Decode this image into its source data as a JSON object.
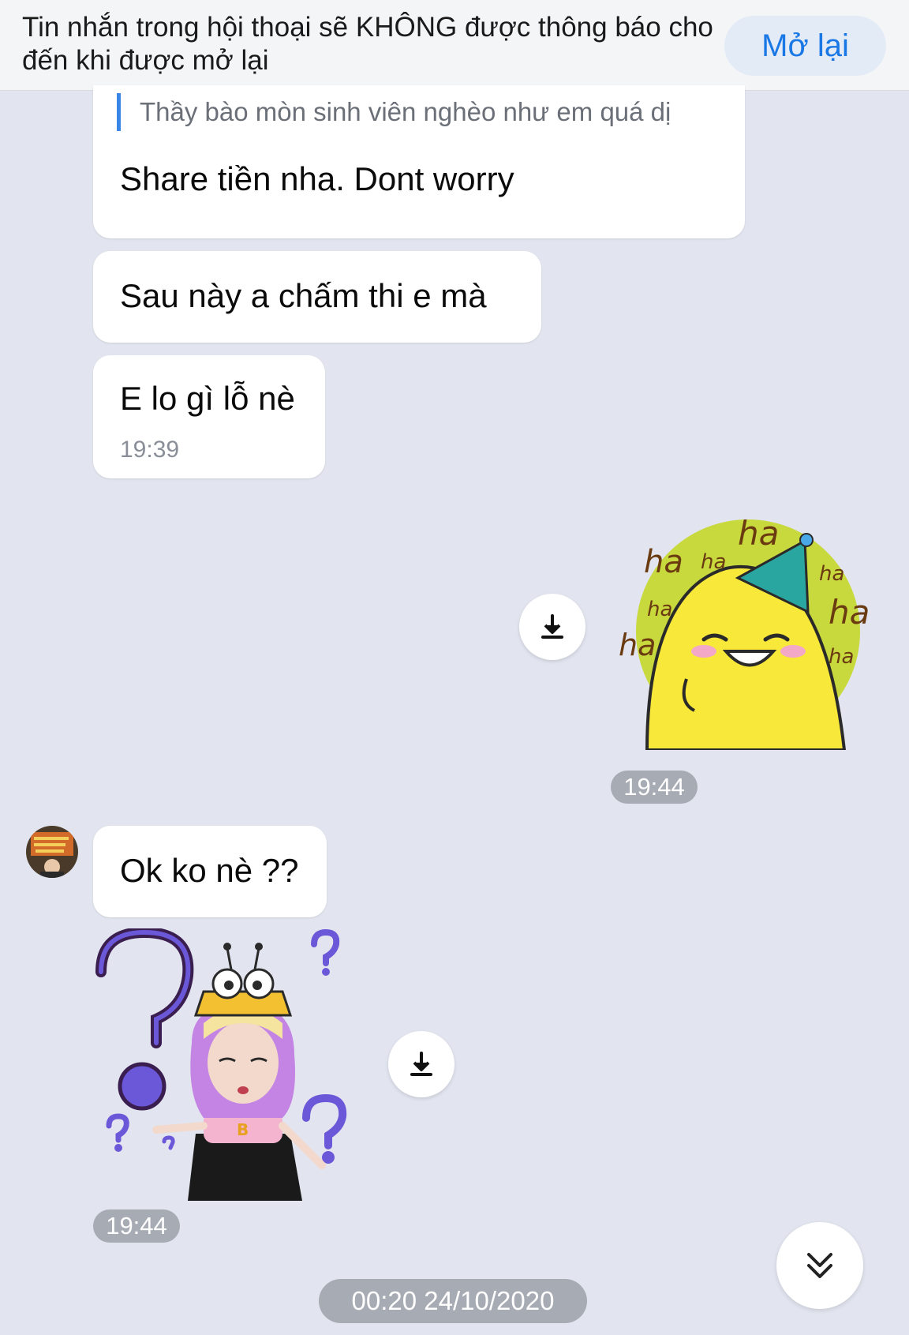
{
  "banner": {
    "text": "Tin nhắn trong hội thoại sẽ KHÔNG được thông báo cho đến khi được mở lại",
    "reopen_label": "Mở lại"
  },
  "messages": {
    "quoted_text": "Thầy bào mòn sinh viên nghèo như em quá dị",
    "reply_text": "Share tiền nha.  Dont worry",
    "msg2_text": "Sau này a chấm thi e mà",
    "msg3_text": "E lo gì lỗ nè",
    "msg3_time": "19:39",
    "sticker1_time": "19:44",
    "msg4_text": "Ok ko nè ??",
    "sticker2_time": "19:44"
  },
  "stickers": {
    "duck_words": [
      "ha",
      "ha",
      "ha",
      "ha",
      "ha",
      "ha",
      "ha",
      "ha"
    ],
    "girl_shirt_letter": "B"
  },
  "date_separator": "00:20 24/10/2020",
  "icons": {
    "download": "download-icon",
    "scroll_down": "double-chevron-down-icon",
    "avatar": "avatar"
  },
  "colors": {
    "accent": "#1a78e6",
    "background": "#e2e5ef",
    "quote_bar": "#3a86e6",
    "time_pill": "#a7abb4"
  }
}
